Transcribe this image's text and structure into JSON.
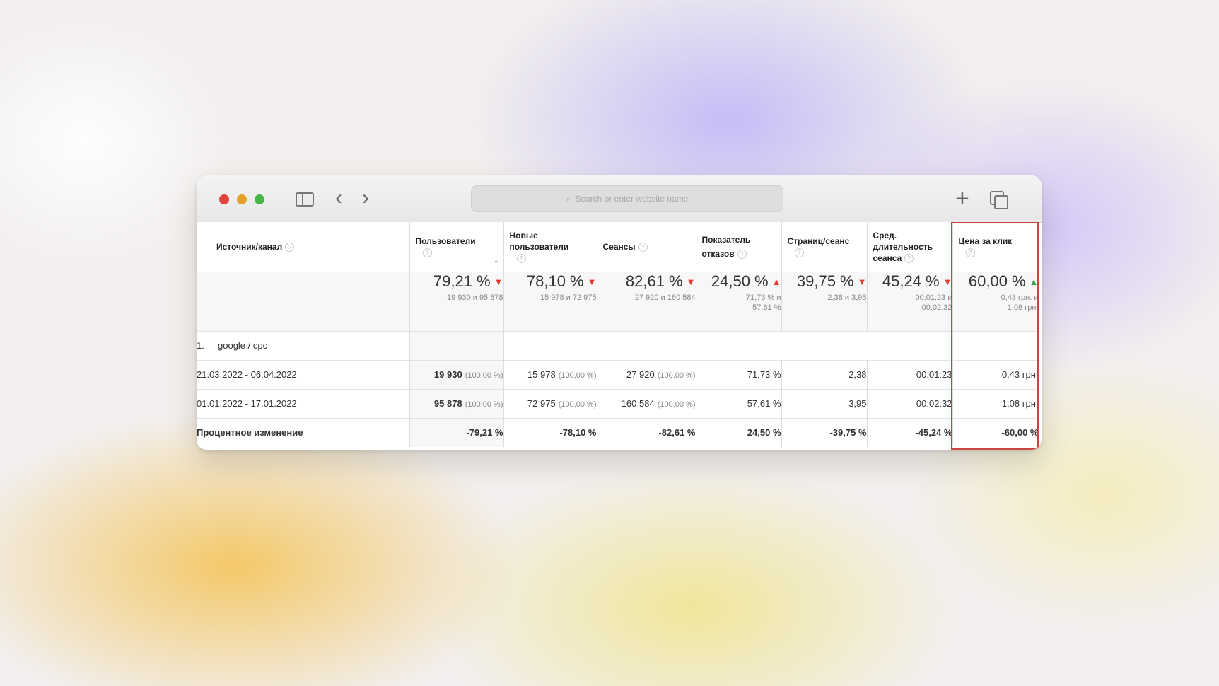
{
  "window": {
    "address_placeholder": "Search or enter website name"
  },
  "table": {
    "headers": {
      "source": "Источник/канал",
      "users": "Пользователи",
      "new_users": "Новые пользователи",
      "sessions": "Сеансы",
      "bounce": "Показатель отказов",
      "pages_per_session": "Страниц/сеанс",
      "avg_duration": "Сред. длительность сеанса",
      "cpc": "Цена за клик"
    },
    "summary": {
      "users": {
        "value": "79,21 %",
        "detail": "19 930 и 95 878"
      },
      "new_users": {
        "value": "78,10 %",
        "detail": "15 978 и 72 975"
      },
      "sessions": {
        "value": "82,61 %",
        "detail": "27 920 и 160 584"
      },
      "bounce": {
        "value": "24,50 %",
        "detail1": "71,73 % и",
        "detail2": "57,61 %"
      },
      "pages_per_session": {
        "value": "39,75 %",
        "detail": "2,38 и 3,95"
      },
      "avg_duration": {
        "value": "45,24 %",
        "detail1": "00:01:23 и",
        "detail2": "00:02:32"
      },
      "cpc": {
        "value": "60,00 %",
        "detail1": "0,43 грн. и",
        "detail2": "1,08 грн."
      }
    },
    "group": {
      "index": "1.",
      "name": "google / cpc"
    },
    "rows": [
      {
        "label": "21.03.2022 - 06.04.2022",
        "users": "19 930",
        "users_pct": "(100,00 %)",
        "new_users": "15 978",
        "new_users_pct": "(100,00 %)",
        "sessions": "27 920",
        "sessions_pct": "(100,00 %)",
        "bounce": "71,73 %",
        "pages": "2,38",
        "duration": "00:01:23",
        "cpc": "0,43 грн."
      },
      {
        "label": "01.01.2022 - 17.01.2022",
        "users": "95 878",
        "users_pct": "(100,00 %)",
        "new_users": "72 975",
        "new_users_pct": "(100,00 %)",
        "sessions": "160 584",
        "sessions_pct": "(100,00 %)",
        "bounce": "57,61 %",
        "pages": "3,95",
        "duration": "00:02:32",
        "cpc": "1,08 грн."
      }
    ],
    "change": {
      "label": "Процентное изменение",
      "users": "-79,21 %",
      "new_users": "-78,10 %",
      "sessions": "-82,61 %",
      "bounce": "24,50 %",
      "pages": "-39,75 %",
      "duration": "-45,24 %",
      "cpc": "-60,00 %"
    }
  },
  "colors": {
    "arrow_negative": "#e23a2e",
    "arrow_positive": "#35a63c",
    "highlight_border": "#c8463f"
  },
  "icons": {
    "arrow_down_red": "▼",
    "arrow_up_red": "▲",
    "arrow_up_green": "▲",
    "help": "?",
    "sort": "↓"
  }
}
